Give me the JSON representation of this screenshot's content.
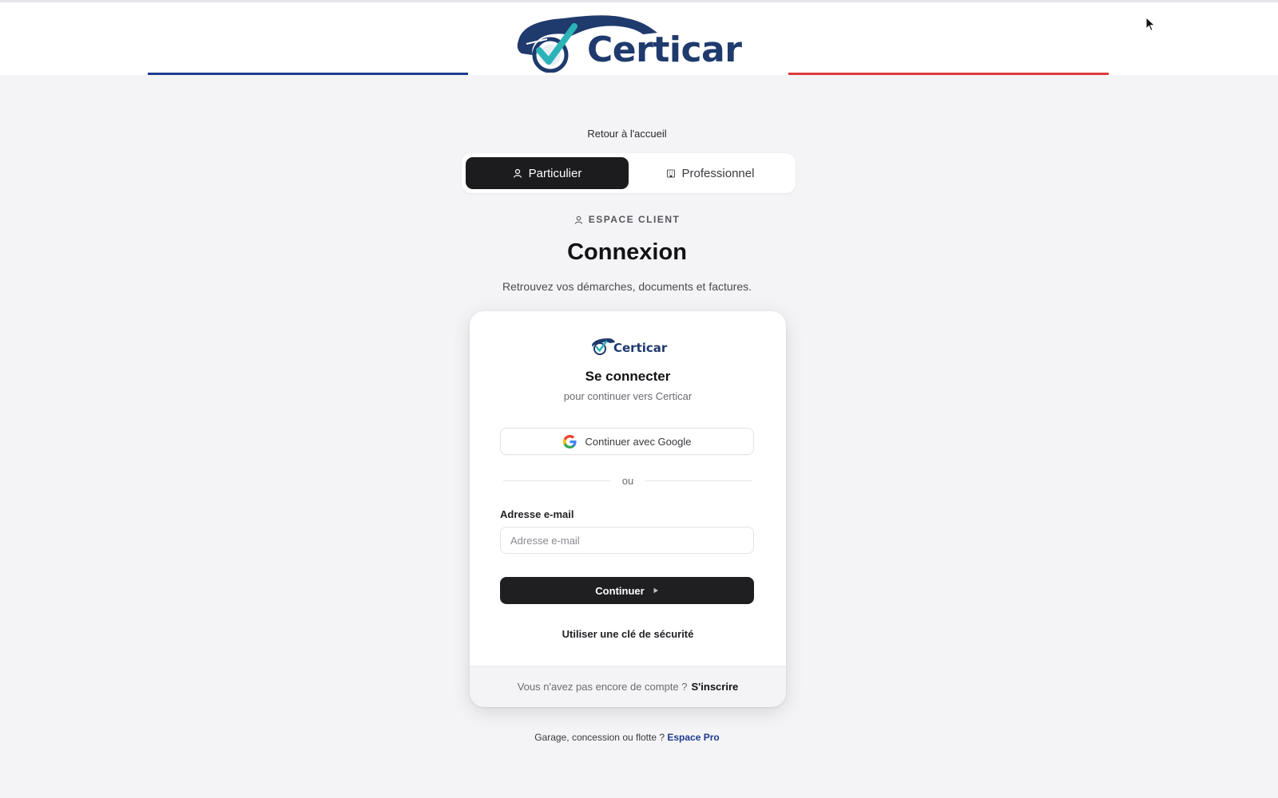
{
  "brand": {
    "name": "Certicar",
    "colors": {
      "navy": "#1f3a6d",
      "blue": "#1f3a8f",
      "red": "#e03a3e",
      "check": "#2bb3b8"
    }
  },
  "nav": {
    "back_label": "Retour à l'accueil"
  },
  "account_type": {
    "options": [
      {
        "label": "Particulier",
        "icon": "user-icon",
        "selected": true
      },
      {
        "label": "Professionnel",
        "icon": "building-icon",
        "selected": false
      }
    ]
  },
  "heading": {
    "eyebrow": "ESPACE CLIENT",
    "title": "Connexion",
    "subtitle": "Retrouvez vos démarches, documents et factures."
  },
  "card": {
    "title": "Se connecter",
    "subtitle": "pour continuer vers Certicar",
    "google_label": "Continuer avec Google",
    "divider_label": "ou",
    "email_label": "Adresse e-mail",
    "email_placeholder": "Adresse e-mail",
    "email_value": "",
    "continue_label": "Continuer",
    "security_key_label": "Utiliser une clé de sécurité",
    "footer_text": "Vous n'avez pas encore de compte ?",
    "signup_label": "S'inscrire"
  },
  "pro": {
    "text": "Garage, concession ou flotte ?",
    "link_label": "Espace Pro"
  }
}
